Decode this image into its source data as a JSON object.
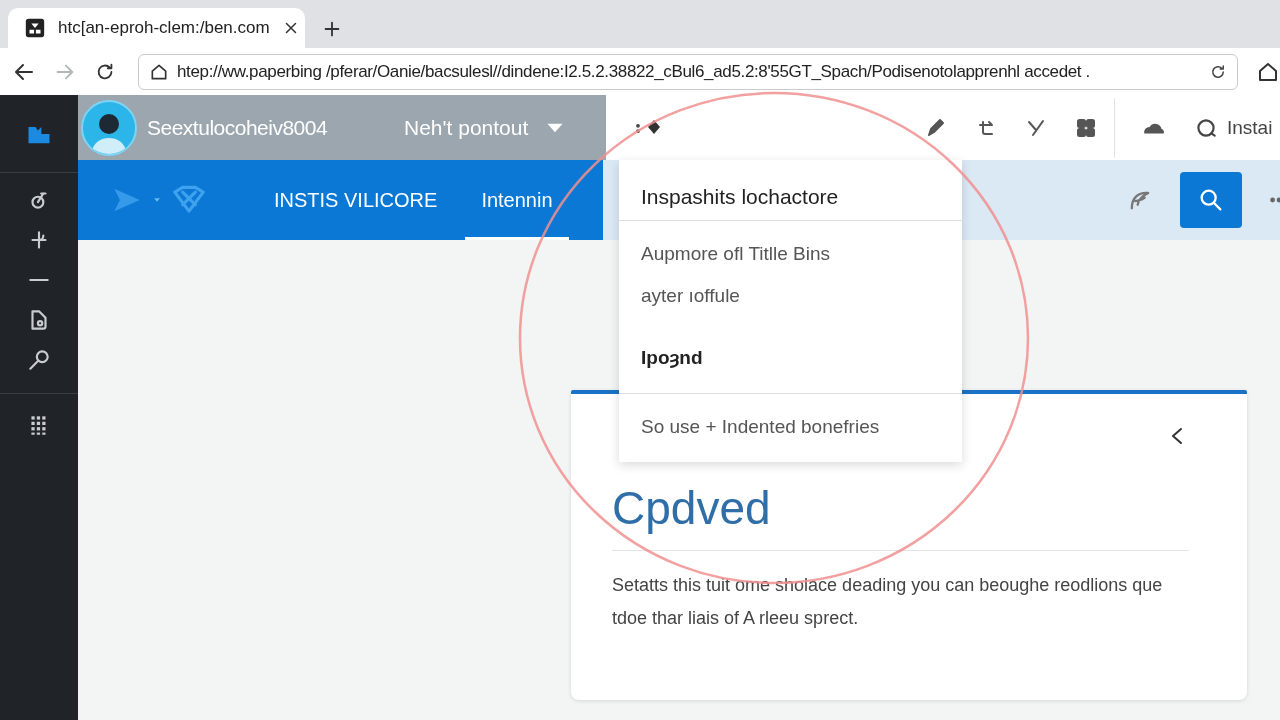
{
  "browser": {
    "tab": {
      "title": "htc[an-eproh-clem:/ben.com"
    },
    "forward_button": {
      "disabled": true
    },
    "address": "htep://ww.paperbing /pferar/Oanie/bacsulesl//dindene:I2.5.2.38822_cBul6_ad5.2:8'55GT_Spach/Podisenotolapprenhl accedet ."
  },
  "header": {
    "user": "Seextulocoheiv8004",
    "menu_label": "Neh't pontout",
    "toolbar_text": "Instai"
  },
  "nav": {
    "tabs": [
      {
        "label": "INSTIS VILICORE",
        "selected": false
      },
      {
        "label": "Intennin",
        "selected": true
      }
    ]
  },
  "dropdown": {
    "title": "Inspashits lochactore",
    "items": [
      {
        "label": "Aupmore ofl Titlle Bins",
        "kind": "item"
      },
      {
        "label": "ayter ıoffule",
        "kind": "item"
      },
      {
        "label": "Ipoȝnd",
        "kind": "heading"
      },
      {
        "label": "So use + Indented bonefries",
        "kind": "item"
      }
    ]
  },
  "card": {
    "heading": "Cpdved",
    "body": "Setatts this tuit ome sholace deading you can beoughe reodlions que tdoe thar liais of A rleeu sprect."
  }
}
